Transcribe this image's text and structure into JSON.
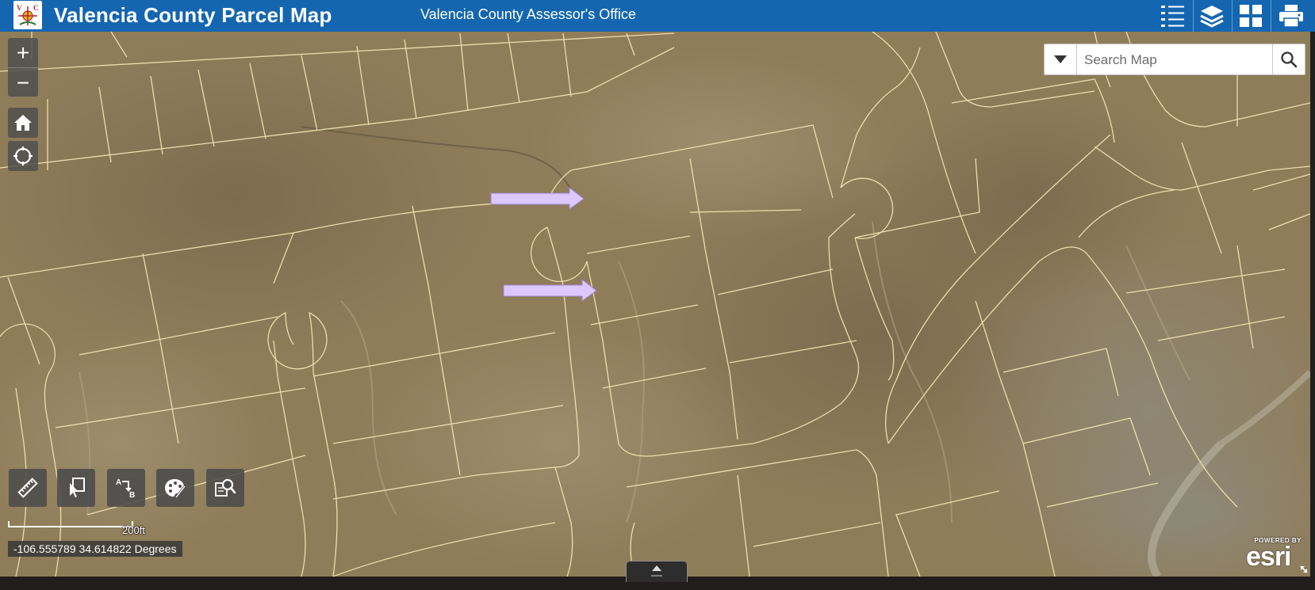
{
  "header": {
    "title": "Valencia County Parcel Map",
    "subtitle": "Valencia County Assessor's Office",
    "logo_icon": "county-seal-logo",
    "buttons": [
      {
        "icon": "legend-list-icon"
      },
      {
        "icon": "layers-icon"
      },
      {
        "icon": "basemap-gallery-icon"
      },
      {
        "icon": "print-icon"
      }
    ],
    "background_color": "#1466b0"
  },
  "map": {
    "zoom_in_label": "+",
    "zoom_out_label": "−",
    "home_icon": "home-icon",
    "locate_icon": "locate-icon",
    "search": {
      "placeholder": "Search Map",
      "value": "",
      "dropdown_icon": "caret-down-icon",
      "search_icon": "search-icon"
    },
    "tools": [
      {
        "icon": "measure-icon"
      },
      {
        "icon": "select-icon"
      },
      {
        "icon": "directions-icon"
      },
      {
        "icon": "draw-icon"
      },
      {
        "icon": "query-icon"
      }
    ],
    "scale_label": "200ft",
    "coordinates": "-106.555789 34.614822 Degrees",
    "attribution": {
      "powered_by": "POWERED BY",
      "brand": "esri"
    },
    "parcel_line_color": "#f4e6b4",
    "annotation_arrow_color": "#dcc8ff"
  }
}
